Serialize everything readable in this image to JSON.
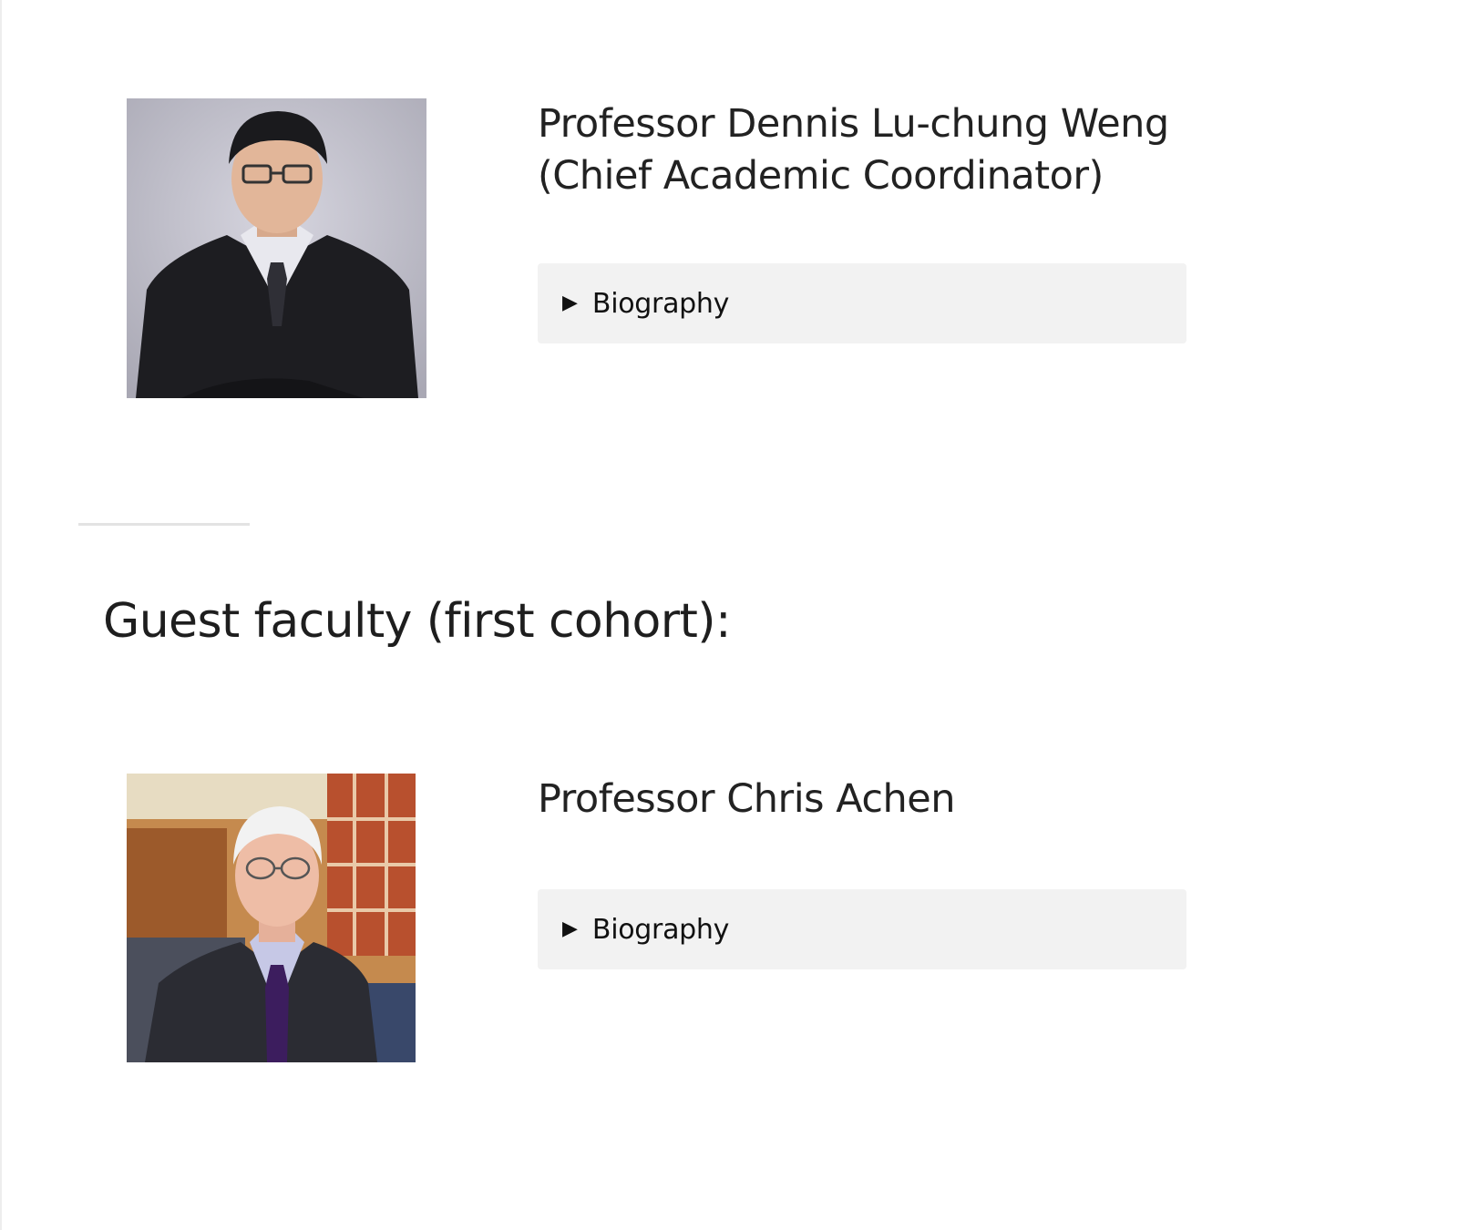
{
  "faculty": [
    {
      "name_lines": [
        "Professor Dennis Lu-chung Weng",
        "(Chief Academic Coordinator)"
      ],
      "photo_icon": "portrait-photo",
      "biography_toggle": {
        "arrow": "▶",
        "label": "Biography"
      }
    },
    {
      "name_lines": [
        "Professor Chris Achen"
      ],
      "photo_icon": "portrait-photo",
      "biography_toggle": {
        "arrow": "▶",
        "label": "Biography"
      }
    }
  ],
  "guest_section": {
    "heading": "Guest faculty (first cohort):"
  },
  "colors": {
    "text": "#222222",
    "toggle_background": "#f2f2f2",
    "divider": "#e3e3e3"
  }
}
